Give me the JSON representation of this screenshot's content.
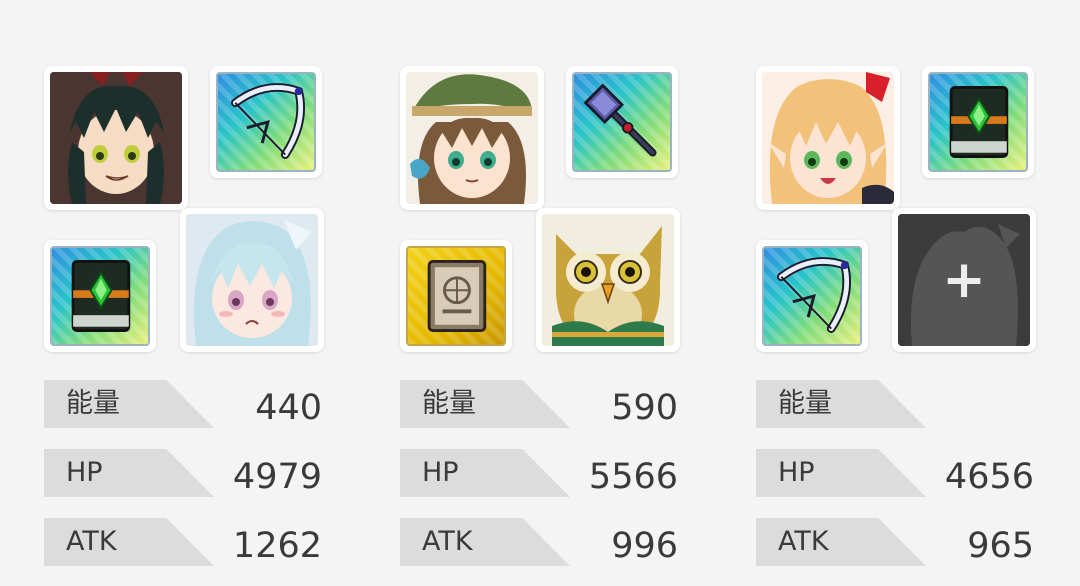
{
  "teams": [
    {
      "leader": {
        "name": "dark-haired-boy-portrait"
      },
      "leader_item": {
        "icon": "bow-icon",
        "background": "rainbow"
      },
      "support_item": {
        "icon": "green-gem-book-icon",
        "background": "rainbow"
      },
      "support": {
        "name": "white-haired-girl-portrait"
      },
      "stats": [
        {
          "label": "能量",
          "value": "440"
        },
        {
          "label": "HP",
          "value": "4979"
        },
        {
          "label": "ATK",
          "value": "1262"
        }
      ]
    },
    {
      "leader": {
        "name": "green-hat-girl-portrait"
      },
      "leader_item": {
        "icon": "hammer-icon",
        "background": "rainbow"
      },
      "support_item": {
        "icon": "tome-icon",
        "background": "gold"
      },
      "support": {
        "name": "owl-portrait"
      },
      "stats": [
        {
          "label": "能量",
          "value": "590"
        },
        {
          "label": "HP",
          "value": "5566"
        },
        {
          "label": "ATK",
          "value": "996"
        }
      ]
    },
    {
      "leader": {
        "name": "blonde-elf-girl-portrait"
      },
      "leader_item": {
        "icon": "green-gem-book-icon",
        "background": "rainbow"
      },
      "support_item": {
        "icon": "bow-icon",
        "background": "rainbow"
      },
      "support": {
        "name": "empty-slot",
        "plus": "+"
      },
      "stats": [
        {
          "label": "能量",
          "value": ""
        },
        {
          "label": "HP",
          "value": "4656"
        },
        {
          "label": "ATK",
          "value": "965"
        }
      ]
    }
  ],
  "colors": {
    "background": "#f4f4f4",
    "label_bg": "#dcdcdc",
    "text": "#3a3a3a",
    "empty_slot": "#3c3c3c"
  }
}
